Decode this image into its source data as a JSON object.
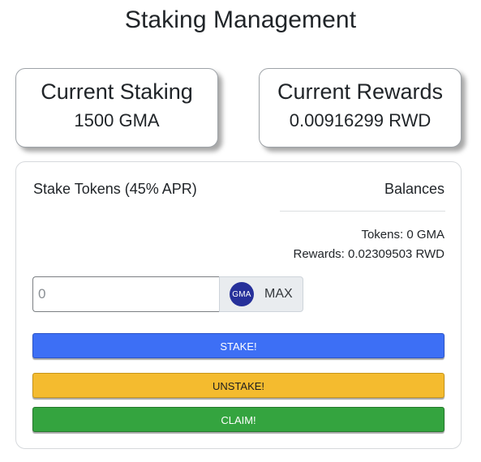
{
  "page": {
    "title": "Staking Management"
  },
  "current_staking": {
    "title": "Current Staking",
    "value": "1500 GMA"
  },
  "current_rewards": {
    "title": "Current Rewards",
    "value": "0.00916299 RWD"
  },
  "stake_panel": {
    "heading": "Stake Tokens (45% APR)",
    "balances_heading": "Balances",
    "tokens_balance": "Tokens: 0 GMA",
    "rewards_balance": "Rewards: 0.02309503 RWD",
    "amount_input": {
      "value": "",
      "placeholder": "0"
    },
    "token_logo_text": "GMA",
    "max_label": "MAX",
    "stake_label": "STAKE!",
    "unstake_label": "UNSTAKE!",
    "claim_label": "CLAIM!"
  },
  "colors": {
    "stake": "#3d6ff5",
    "unstake": "#f4bb2f",
    "claim": "#34a43f",
    "token_logo": "#26309a"
  }
}
